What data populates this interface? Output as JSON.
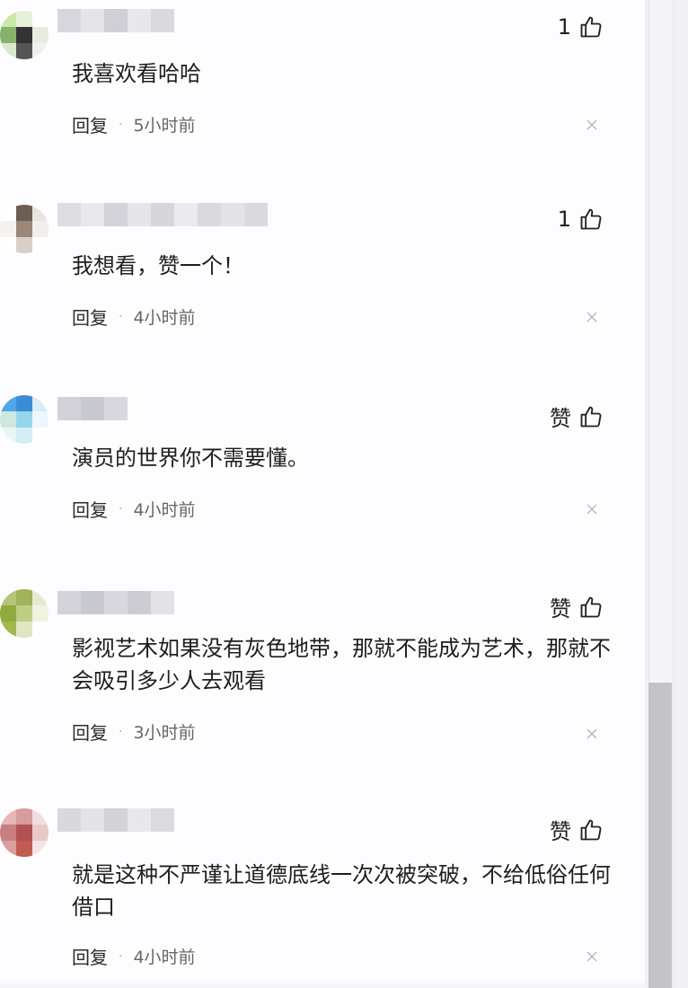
{
  "comments": [
    {
      "like_label": "1",
      "text": "我喜欢看哈哈",
      "reply_label": "回复",
      "separator": "·",
      "time": "5小时前",
      "avatar_colors": [
        "#c9e8a9",
        "#e7f1dc",
        "#ffffff",
        "#88b26b",
        "#333333",
        "#e6ece0",
        "#d8e8cc",
        "#555555",
        "#f0f0f0"
      ]
    },
    {
      "like_label": "1",
      "text": "我想看，赞一个！",
      "reply_label": "回复",
      "separator": "·",
      "time": "4小时前",
      "avatar_colors": [
        "#ffffff",
        "#6d5e55",
        "#e9e4df",
        "#f4f1ee",
        "#9a8879",
        "#f2eeea",
        "#ffffff",
        "#d8cfc7",
        "#ffffff"
      ]
    },
    {
      "like_label": "赞",
      "text": "演员的世界你不需要懂。",
      "reply_label": "回复",
      "separator": "·",
      "time": "4小时前",
      "avatar_colors": [
        "#4fa9e6",
        "#3b8cd6",
        "#d9ecf9",
        "#cfe7e0",
        "#96d6ea",
        "#eef7fb",
        "#eaf6f3",
        "#d3eef4",
        "#ffffff"
      ]
    },
    {
      "like_label": "赞",
      "text": "影视艺术如果没有灰色地带，那就不能成为艺术，那就不会吸引多少人去观看",
      "reply_label": "回复",
      "separator": "·",
      "time": "3小时前",
      "avatar_colors": [
        "#b6c47b",
        "#9fb35a",
        "#e5ebcf",
        "#8fab3c",
        "#c0cd84",
        "#f0f3e2",
        "#a2b94d",
        "#dfe6c4",
        "#ffffff"
      ]
    },
    {
      "like_label": "赞",
      "text": "就是这种不严谨让道德底线一次次被突破，不给低俗任何借口",
      "reply_label": "回复",
      "separator": "·",
      "time": "4小时前",
      "avatar_colors": [
        "#e7b7b8",
        "#d99b9d",
        "#f2dedf",
        "#c97f80",
        "#b25253",
        "#eac8c9",
        "#d9a09d",
        "#c05b52",
        "#f4e4e3"
      ]
    }
  ],
  "icons": {
    "like": "thumbs-up-icon",
    "close": "close-icon"
  },
  "colors": {
    "text": "#1e1e1e",
    "secondary": "#666666",
    "scrollbar_thumb": "#c4c4c7"
  }
}
